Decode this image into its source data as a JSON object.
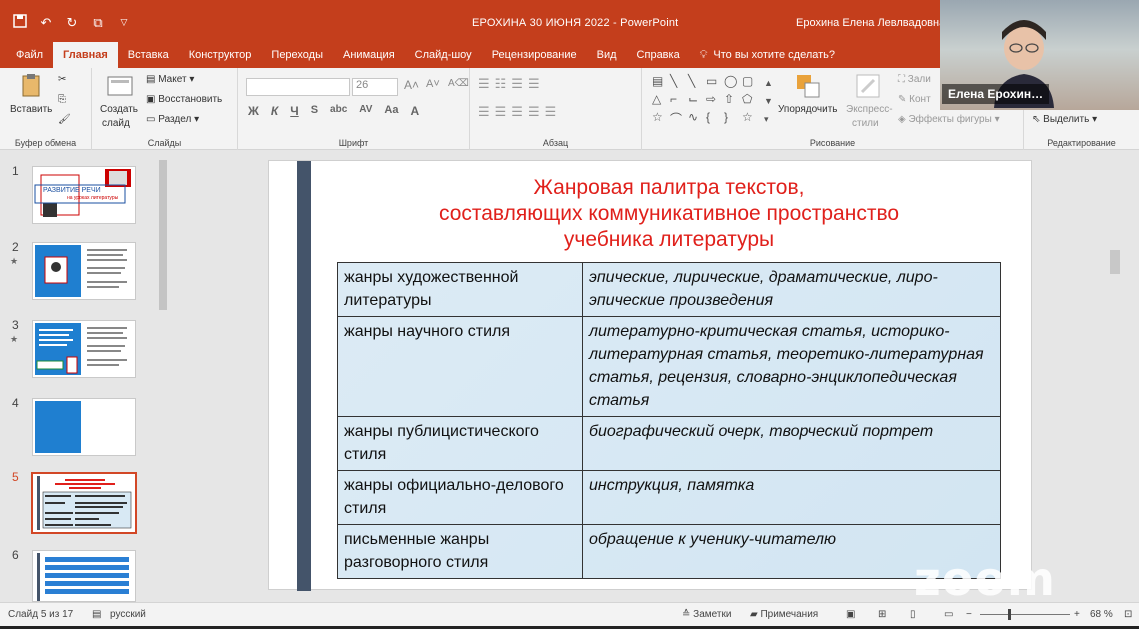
{
  "window": {
    "doc_title": "ЕРОХИНА 30 ИЮНЯ 2022 - PowerPoint",
    "user": "Ерохина Елена Левлвадовна"
  },
  "tabs": [
    "Файл",
    "Главная",
    "Вставка",
    "Конструктор",
    "Переходы",
    "Анимация",
    "Слайд-шоу",
    "Рецензирование",
    "Вид",
    "Справка"
  ],
  "tell_me": "Что вы хотите сделать?",
  "ribbon": {
    "clipboard": {
      "paste": "Вставить",
      "label": "Буфер обмена"
    },
    "slides": {
      "new_slide_1": "Создать",
      "new_slide_2": "слайд",
      "layout": "Макет",
      "reset": "Восстановить",
      "section": "Раздел",
      "label": "Слайды"
    },
    "font": {
      "size": "26",
      "bold": "Ж",
      "italic": "К",
      "underline": "Ч",
      "strike": "S",
      "abc": "abc",
      "spacing": "AV",
      "case": "Aa",
      "color": "A",
      "label": "Шрифт"
    },
    "paragraph": {
      "label": "Абзац"
    },
    "drawing": {
      "arrange_1": "Упорядочить",
      "arrange_2": "",
      "quick_styles_1": "Экспресс-",
      "quick_styles_2": "стили",
      "fill": "Зали",
      "outline": "Конт",
      "effects": "Эффекты фигуры",
      "label": "Рисование"
    },
    "editing": {
      "select": "Выделить",
      "label": "Редактирование"
    }
  },
  "webcam": {
    "name": "Елена Ерохин…"
  },
  "thumbnails": [
    {
      "num": "1",
      "star": false,
      "title": "РАЗВИТИЕ РЕЧИ",
      "subtitle": "на уроках литературы"
    },
    {
      "num": "2",
      "star": true
    },
    {
      "num": "3",
      "star": true
    },
    {
      "num": "4",
      "star": false
    },
    {
      "num": "5",
      "star": false,
      "selected": true
    },
    {
      "num": "6",
      "star": false
    }
  ],
  "slide": {
    "title_lines": [
      "Жанровая палитра текстов,",
      "составляющих коммуникативное пространство",
      "учебника литературы"
    ],
    "rows": [
      {
        "genre": "жанры художественной литературы",
        "examples": "эпические, лирические, драматические, лиро-эпические произведения"
      },
      {
        "genre": "жанры научного стиля",
        "examples": "литературно-критическая статья, историко-литературная статья, теоретико-литературная статья, рецензия, словарно-энциклопедическая статья"
      },
      {
        "genre": "жанры публицистического стиля",
        "examples": "биографический очерк, творческий портрет"
      },
      {
        "genre": "жанры официально-делового стиля",
        "examples": "инструкция, памятка"
      },
      {
        "genre": "письменные жанры разговорного стиля",
        "examples": "обращение к ученику-читателю"
      }
    ]
  },
  "status": {
    "slide_info": "Слайд 5 из 17",
    "language": "русский",
    "notes": "Заметки",
    "comments": "Примечания",
    "zoom": "68 %"
  },
  "overlay": {
    "zoom_logo": "zoom"
  },
  "colors": {
    "accent": "#c43e1c",
    "title_red": "#e0201b",
    "slide_bar": "#44546a"
  }
}
